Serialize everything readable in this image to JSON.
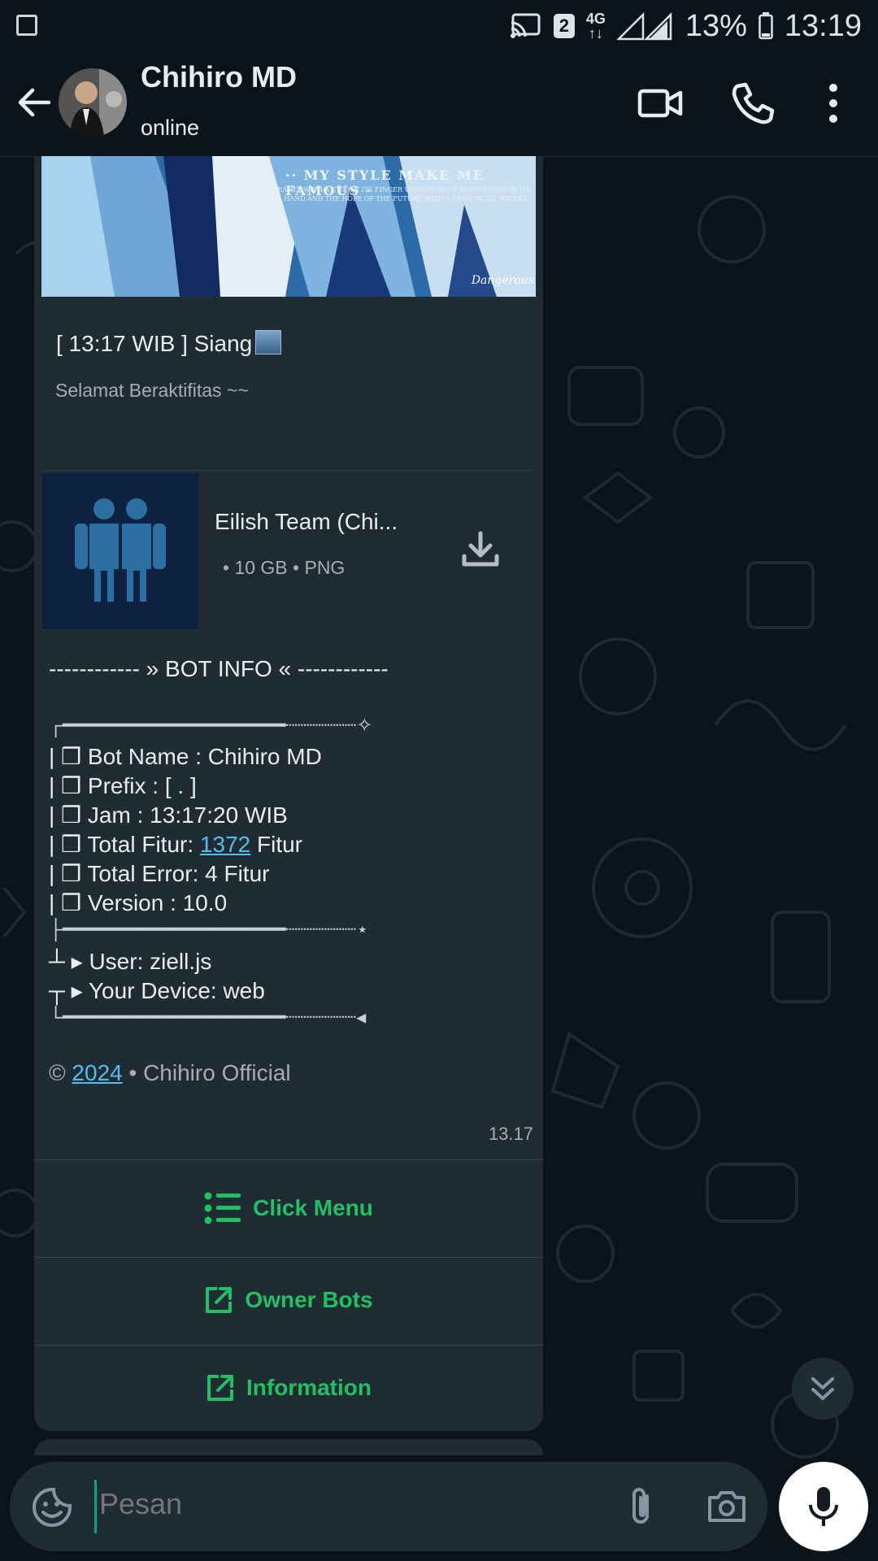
{
  "status_bar": {
    "network_badge": "2",
    "network_type": "4G",
    "battery": "13%",
    "time": "13:19"
  },
  "header": {
    "title": "Chihiro MD",
    "subtitle": "online"
  },
  "message": {
    "banner": {
      "headline": "·· MY STYLE MAKE ME FAMOUS ·",
      "tagline": "BEAUTY WITH A CUT ON ITS FINGER WISDOM WITH BUBBLE GUM IN ITS HAND AND THE HOPE OF THE FUTURE WITH A FROG IN ITS POCKET.\"",
      "signature": "Dangerous"
    },
    "greeting": "[ 13:17 WIB ] Siang",
    "sub_greeting": "Selamat Beraktifitas ~~",
    "document": {
      "name": "Eilish Team (Chi...",
      "meta": "• 10 GB • PNG"
    },
    "bot_info_title": "------------ » BOT INFO « ------------",
    "tree_top": "┌━━━━━━━━━━━━━━━━━━━┈┈┈┈┈┈✧",
    "lines": [
      {
        "prefix": "| ❒ Bot Name : Chihiro MD",
        "link": "",
        "suffix": ""
      },
      {
        "prefix": "| ❒ Prefix : [ . ]",
        "link": "",
        "suffix": ""
      },
      {
        "prefix": "| ❒ Jam : 13:17:20 WIB",
        "link": "",
        "suffix": ""
      },
      {
        "prefix": "| ❒ Total Fitur: ",
        "link": "1372",
        "suffix": " Fitur"
      },
      {
        "prefix": "| ❒ Total Error: 4 Fitur",
        "link": "",
        "suffix": ""
      },
      {
        "prefix": "| ❒ Version : 10.0",
        "link": "",
        "suffix": ""
      }
    ],
    "tree_mid": "├━━━━━━━━━━━━━━━━━━━┈┈┈┈┈┈⋆",
    "user_line": "┴ ▸ User: ziell.js",
    "device_line": "┬ ▸ Your Device: web",
    "tree_bottom": "└━━━━━━━━━━━━━━━━━━━┈┈┈┈┈┈◂",
    "footer_prefix": "© ",
    "footer_link": "2024",
    "footer_suffix": " • Chihiro Official",
    "timestamp": "13.17",
    "buttons": [
      {
        "label": "Click Menu",
        "icon": "list-icon"
      },
      {
        "label": "Owner Bots",
        "icon": "external-link-icon"
      },
      {
        "label": "Information",
        "icon": "external-link-icon"
      }
    ]
  },
  "input": {
    "placeholder": "Pesan"
  },
  "colors": {
    "accent": "#21c063",
    "link": "#53bdeb",
    "background": "#0b141a",
    "bubble": "#202c33"
  }
}
